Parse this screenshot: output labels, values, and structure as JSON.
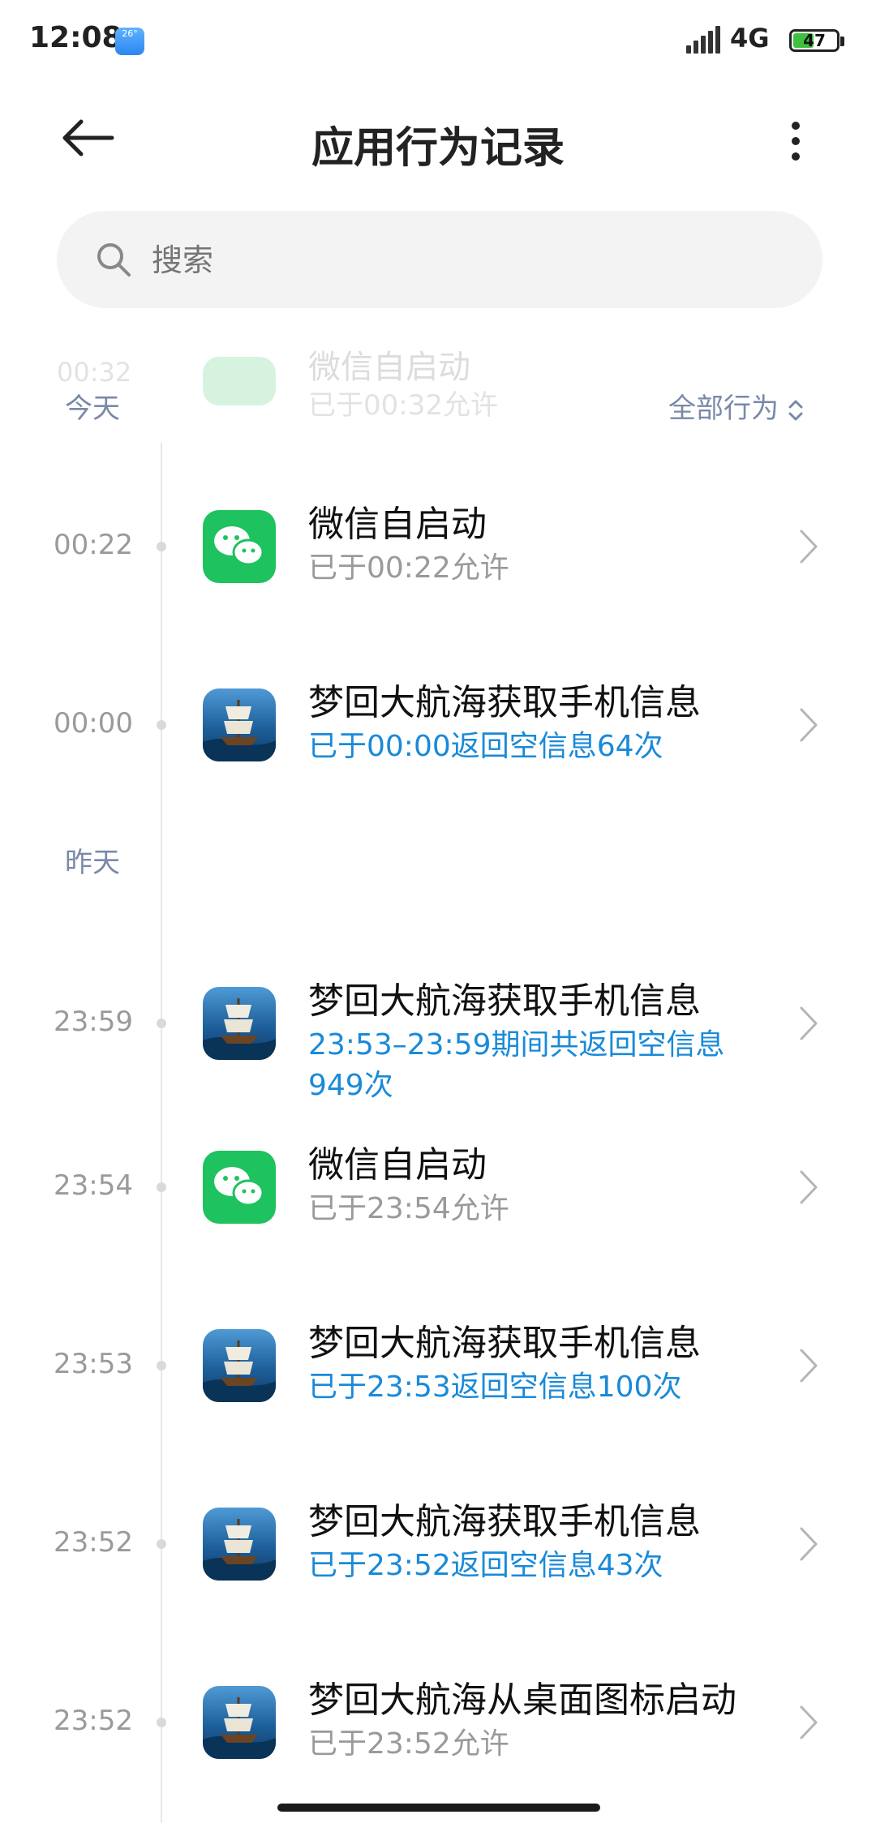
{
  "status_bar": {
    "time": "12:08",
    "weather_temp": "26°",
    "network": "4G",
    "battery": "47"
  },
  "header": {
    "title": "应用行为记录"
  },
  "search": {
    "placeholder": "搜索"
  },
  "ghost_row": {
    "time": "00:32",
    "title": "微信自启动",
    "subtitle": "已于00:32允许"
  },
  "sections": {
    "today": "今天",
    "yesterday": "昨天",
    "filter_label": "全部行为"
  },
  "records": [
    {
      "time": "00:22",
      "app": "wechat",
      "title": "微信自启动",
      "subtitle": "已于00:22允许",
      "style": "gray"
    },
    {
      "time": "00:00",
      "app": "ship",
      "title": "梦回大航海获取手机信息",
      "subtitle": "已于00:00返回空信息64次",
      "style": "blue"
    },
    {
      "time": "23:59",
      "app": "ship",
      "title": "梦回大航海获取手机信息",
      "subtitle": "23:53–23:59期间共返回空信息949次",
      "style": "blue"
    },
    {
      "time": "23:54",
      "app": "wechat",
      "title": "微信自启动",
      "subtitle": "已于23:54允许",
      "style": "gray"
    },
    {
      "time": "23:53",
      "app": "ship",
      "title": "梦回大航海获取手机信息",
      "subtitle": "已于23:53返回空信息100次",
      "style": "blue"
    },
    {
      "time": "23:52",
      "app": "ship",
      "title": "梦回大航海获取手机信息",
      "subtitle": "已于23:52返回空信息43次",
      "style": "blue"
    },
    {
      "time": "23:52",
      "app": "ship",
      "title": "梦回大航海从桌面图标启动",
      "subtitle": "已于23:52允许",
      "style": "gray"
    }
  ]
}
